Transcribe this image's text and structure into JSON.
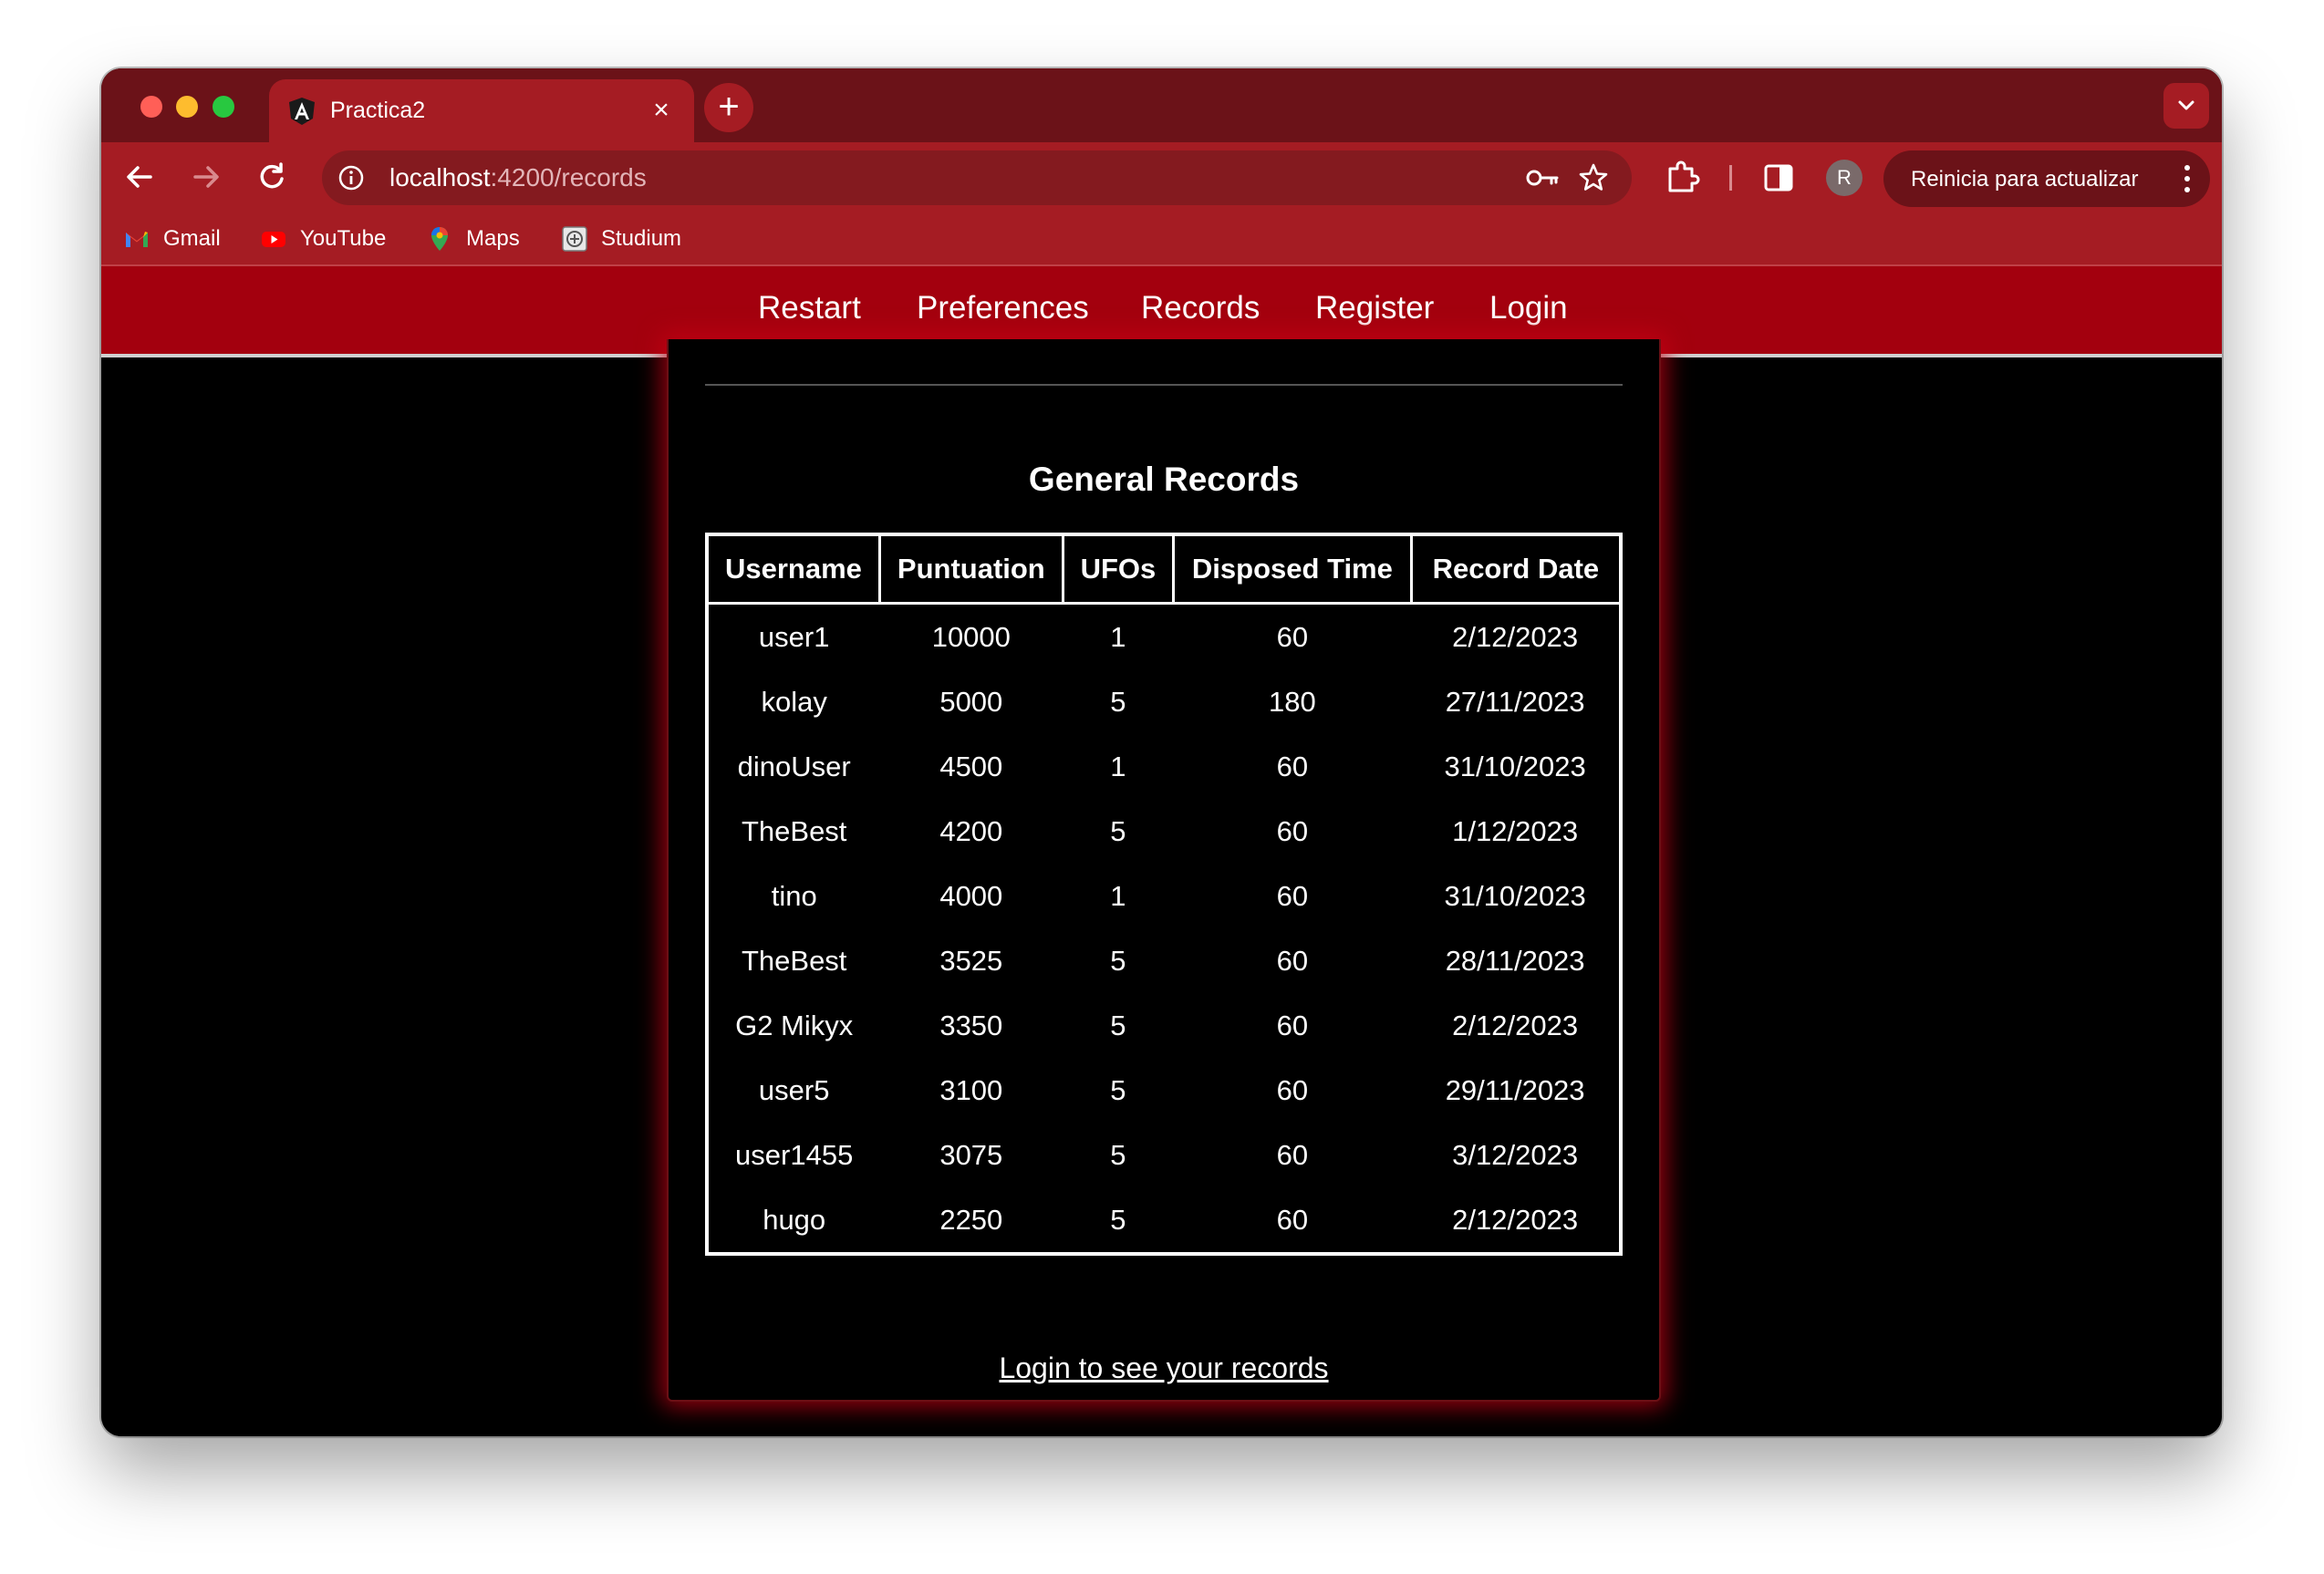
{
  "browser": {
    "tab": {
      "title": "Practica2",
      "favicon": "angular-icon"
    },
    "address": {
      "host": "localhost",
      "path": ":4200/records"
    },
    "update_button": "Reinicia para actualizar",
    "avatar_letter": "R",
    "bookmarks": [
      {
        "label": "Gmail",
        "icon": "gmail-icon"
      },
      {
        "label": "YouTube",
        "icon": "youtube-icon"
      },
      {
        "label": "Maps",
        "icon": "maps-icon"
      },
      {
        "label": "Studium",
        "icon": "studium-icon"
      }
    ]
  },
  "nav": {
    "items": [
      "Restart",
      "Preferences",
      "Records",
      "Register",
      "Login"
    ]
  },
  "records": {
    "title": "General Records",
    "columns": [
      "Username",
      "Puntuation",
      "UFOs",
      "Disposed Time",
      "Record Date"
    ],
    "rows": [
      [
        "user1",
        "10000",
        "1",
        "60",
        "2/12/2023"
      ],
      [
        "kolay",
        "5000",
        "5",
        "180",
        "27/11/2023"
      ],
      [
        "dinoUser",
        "4500",
        "1",
        "60",
        "31/10/2023"
      ],
      [
        "TheBest",
        "4200",
        "5",
        "60",
        "1/12/2023"
      ],
      [
        "tino",
        "4000",
        "1",
        "60",
        "31/10/2023"
      ],
      [
        "TheBest",
        "3525",
        "5",
        "60",
        "28/11/2023"
      ],
      [
        "G2 Mikyx",
        "3350",
        "5",
        "60",
        "2/12/2023"
      ],
      [
        "user5",
        "3100",
        "5",
        "60",
        "29/11/2023"
      ],
      [
        "user1455",
        "3075",
        "5",
        "60",
        "3/12/2023"
      ],
      [
        "hugo",
        "2250",
        "5",
        "60",
        "2/12/2023"
      ]
    ],
    "login_link": "Login to see your records"
  },
  "colors": {
    "tabstrip": "#6b1218",
    "toolbar": "#a51c23",
    "app_nav": "#a3000e",
    "glow": "#c80014"
  }
}
